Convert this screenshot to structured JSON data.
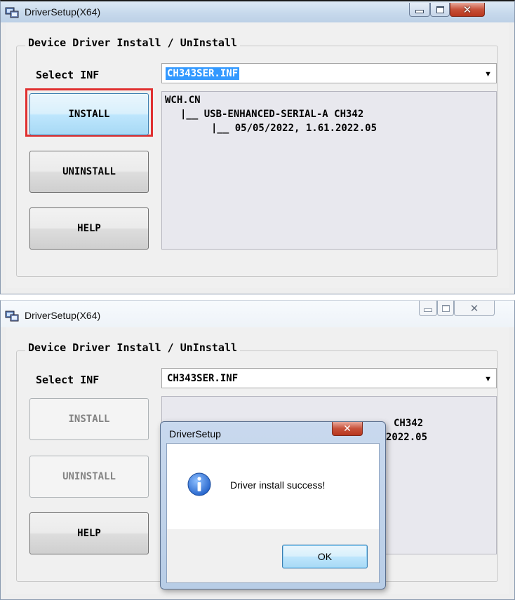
{
  "window1": {
    "title": "DriverSetup(X64)",
    "group_label": "Device Driver Install / UnInstall",
    "select_label": "Select INF",
    "select_value": "CH343SER.INF",
    "buttons": {
      "install": "INSTALL",
      "uninstall": "UNINSTALL",
      "help": "HELP"
    },
    "info_lines": [
      "WCH.CN",
      "|__ USB-ENHANCED-SERIAL-A CH342",
      "|__ 05/05/2022, 1.61.2022.05"
    ]
  },
  "window2": {
    "title": "DriverSetup(X64)",
    "group_label": "Device Driver Install / UnInstall",
    "select_label": "Select INF",
    "select_value": "CH343SER.INF",
    "buttons": {
      "install": "INSTALL",
      "uninstall": "UNINSTALL",
      "help": "HELP"
    },
    "info_lines_partial": [
      "CH342",
      "2022.05"
    ],
    "dialog": {
      "title": "DriverSetup",
      "message": "Driver install success!",
      "ok_label": "OK"
    }
  },
  "icons": {
    "app": "driver-setup-app-icon",
    "minimize": "minimize-icon",
    "maximize": "maximize-icon",
    "close": "close-icon",
    "dropdown": "chevron-down-icon",
    "info": "info-icon"
  },
  "colors": {
    "selection": "#3399ff",
    "highlight_border": "#e03030",
    "close_button": "#c7513a",
    "info_icon": "#2b6fd6"
  }
}
